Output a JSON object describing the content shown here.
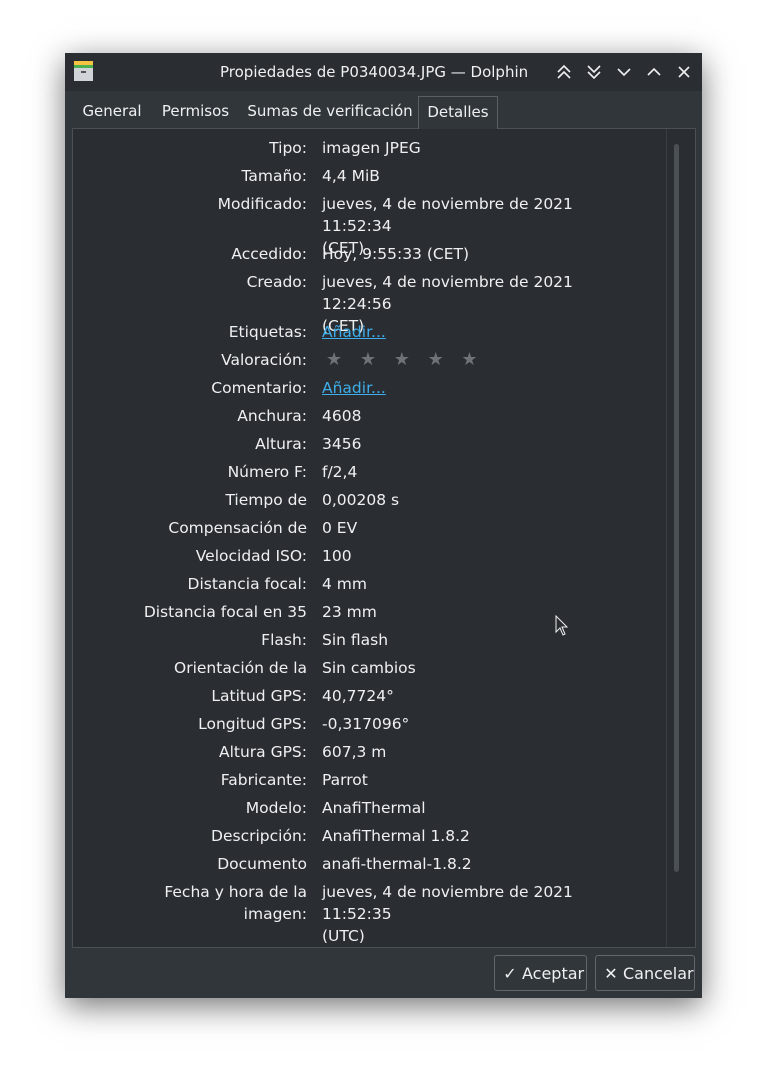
{
  "window": {
    "title": "Propiedades de P0340034.JPG — Dolphin"
  },
  "tabs": [
    {
      "label": "General"
    },
    {
      "label": "Permisos"
    },
    {
      "label": "Sumas de verificación"
    },
    {
      "label": "Detalles"
    }
  ],
  "details": [
    {
      "label": "Tipo:",
      "value": "imagen JPEG"
    },
    {
      "label": "Tamaño:",
      "value": "4,4 MiB"
    },
    {
      "label": "Modificado:",
      "value": "jueves, 4 de noviembre de 2021 11:52:34",
      "value2": "(CET)"
    },
    {
      "label": "Accedido:",
      "value": "Hoy, 9:55:33 (CET)"
    },
    {
      "label": "Creado:",
      "value": "jueves, 4 de noviembre de 2021 12:24:56",
      "value2": "(CET)"
    },
    {
      "label": "Etiquetas:",
      "value": "Añadir..."
    },
    {
      "label": "Valoración:",
      "value": "★ ★ ★ ★ ★",
      "rating": 0,
      "rating_max": 5
    },
    {
      "label": "Comentario:",
      "value": "Añadir..."
    },
    {
      "label": "Anchura:",
      "value": "4608"
    },
    {
      "label": "Altura:",
      "value": "3456"
    },
    {
      "label": "Número F:",
      "value": "f/2,4"
    },
    {
      "label": "Tiempo de",
      "value": "0,00208 s"
    },
    {
      "label": "Compensación de",
      "value": "0 EV"
    },
    {
      "label": "Velocidad ISO:",
      "value": "100"
    },
    {
      "label": "Distancia focal:",
      "value": "4 mm"
    },
    {
      "label": "Distancia focal en 35",
      "value": "23 mm"
    },
    {
      "label": "Flash:",
      "value": "Sin flash"
    },
    {
      "label": "Orientación de la",
      "value": "Sin cambios"
    },
    {
      "label": "Latitud GPS:",
      "value": "40,7724°"
    },
    {
      "label": "Longitud GPS:",
      "value": "-0,317096°"
    },
    {
      "label": "Altura GPS:",
      "value": "607,3 m"
    },
    {
      "label": "Fabricante:",
      "value": "Parrot"
    },
    {
      "label": "Modelo:",
      "value": "AnafiThermal"
    },
    {
      "label": "Descripción:",
      "value": "AnafiThermal 1.8.2"
    },
    {
      "label": "Documento",
      "value": "anafi-thermal-1.8.2"
    },
    {
      "label": "Fecha y hora de la",
      "label2": "imagen:",
      "value": "jueves, 4 de noviembre de 2021 11:52:35",
      "value2": "(UTC)"
    }
  ],
  "buttons": {
    "ok": "Aceptar",
    "cancel": "Cancelar"
  },
  "colors": {
    "accent": "#3daee9",
    "window_bg": "#31363b",
    "panel_bg": "#2a2e32"
  }
}
